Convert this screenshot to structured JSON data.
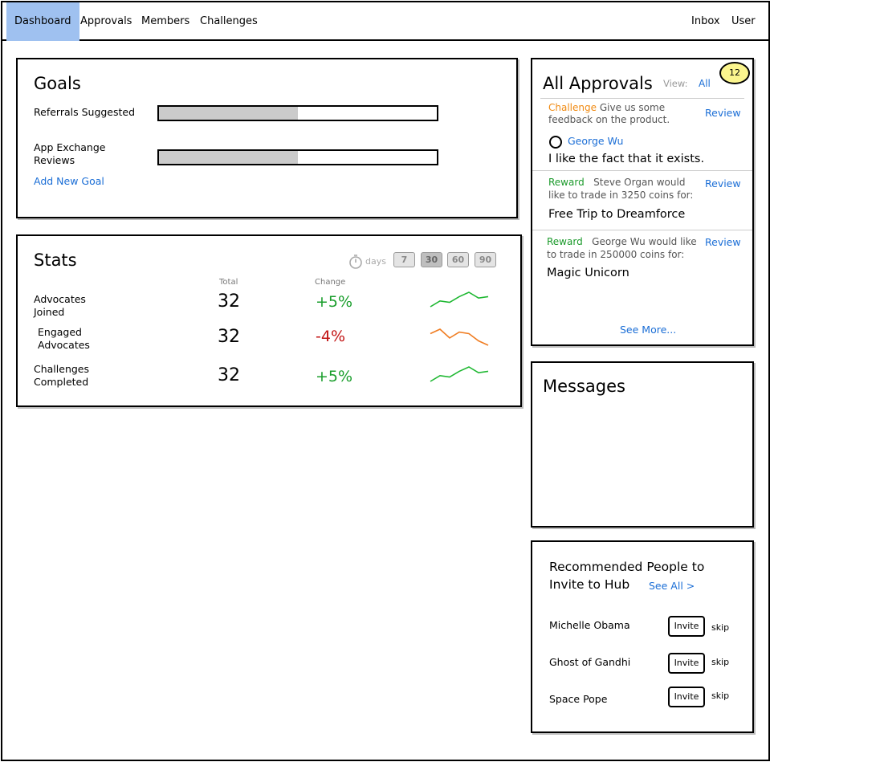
{
  "nav": {
    "dashboard": "Dashboard",
    "approvals": "Approvals",
    "members": "Members",
    "challenges": "Challenges",
    "inbox": "Inbox",
    "user": "User"
  },
  "goals": {
    "title": "Goals",
    "items": [
      {
        "label": "Referrals Suggested",
        "progress": 0.5
      },
      {
        "label_line1": "App Exchange",
        "label_line2": "Reviews",
        "progress": 0.5
      }
    ],
    "add_link": "Add New Goal"
  },
  "stats": {
    "title": "Stats",
    "days_label": "days",
    "day_options": [
      "7",
      "30",
      "60",
      "90"
    ],
    "selected_day": "30",
    "col_total": "Total",
    "col_change": "Change",
    "rows": [
      {
        "line1": "Advocates",
        "line2": "Joined",
        "total": "32",
        "change": "+5%",
        "trend": "up",
        "color": "#1fb832",
        "spark": [
          2,
          6,
          5,
          9,
          12,
          8,
          9
        ]
      },
      {
        "line1": "Engaged",
        "line2": "Advocates",
        "total": "32",
        "change": "-4%",
        "trend": "down",
        "color": "#f07d22",
        "spark": [
          9,
          12,
          6,
          10,
          9,
          4,
          1
        ]
      },
      {
        "line1": "Challenges",
        "line2": "Completed",
        "total": "32",
        "change": "+5%",
        "trend": "up",
        "color": "#1fb832",
        "spark": [
          2,
          6,
          5,
          9,
          12,
          8,
          9
        ]
      }
    ]
  },
  "approvals": {
    "title": "All Approvals",
    "view_label": "View:",
    "view_value": "All",
    "badge_count": "12",
    "review_label": "Review",
    "items": [
      {
        "type": "Challenge",
        "type_color": "#f08a12",
        "desc1": "Give us some",
        "desc2": "feedback on the product.",
        "user": "George Wu",
        "text": "I like the fact that it exists."
      },
      {
        "type": "Reward",
        "type_color": "#1b9a2b",
        "desc1": "Steve Organ would",
        "desc2": "like to trade in 3250 coins for:",
        "text": "Free Trip to Dreamforce"
      },
      {
        "type": "Reward",
        "type_color": "#1b9a2b",
        "desc1": "George Wu would like",
        "desc2": "to trade in 250000 coins for:",
        "text": "Magic Unicorn"
      }
    ],
    "see_more": "See More..."
  },
  "messages": {
    "title": "Messages"
  },
  "recommended": {
    "title_line1": "Recommended People to",
    "title_line2": "Invite to Hub",
    "see_all": "See All >",
    "invite_label": "Invite",
    "skip_label": "skip",
    "people": [
      "Michelle Obama",
      "Ghost of Gandhi",
      "Space Pope"
    ]
  }
}
